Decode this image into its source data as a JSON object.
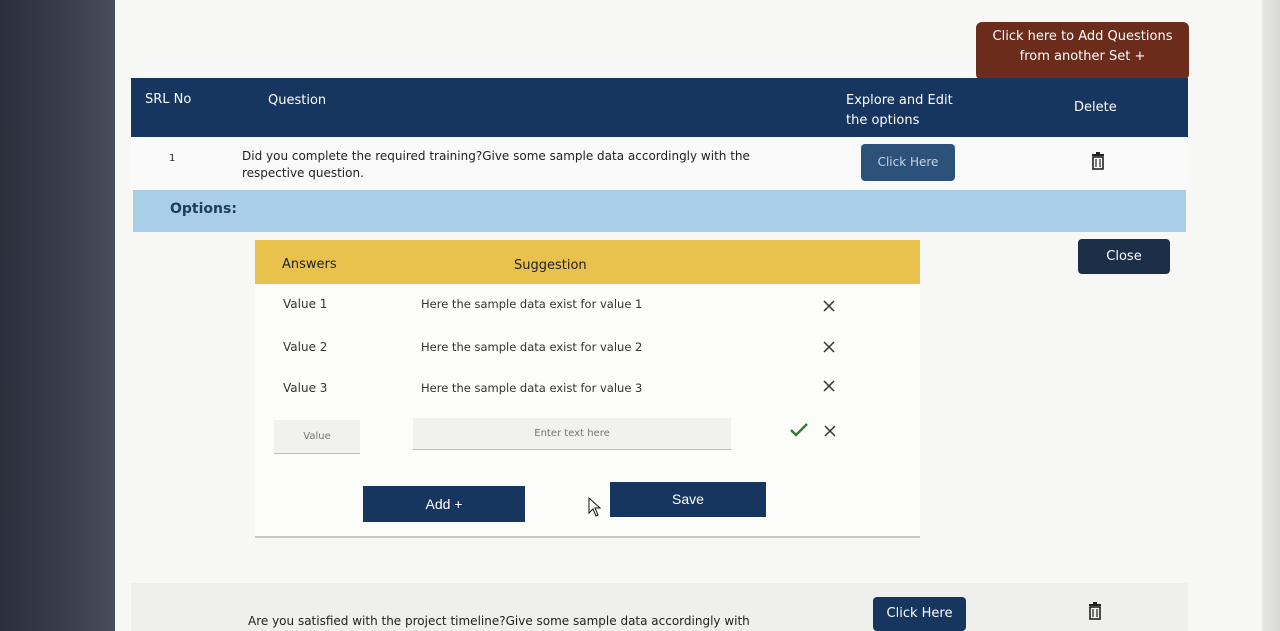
{
  "add_questions_button": {
    "line1": "Click here to Add Questions",
    "line2": "from another Set +"
  },
  "table": {
    "headers": {
      "srl": "SRL No",
      "question": "Question",
      "explore_line1": "Explore and Edit",
      "explore_line2": "the options",
      "delete": "Delete"
    },
    "rows": [
      {
        "num": "1",
        "question": "Did you complete the required training?Give some sample data accordingly with the respective question.",
        "button": "Click Here"
      },
      {
        "question": "Are you satisfied with the project timeline?Give some sample data accordingly with",
        "button": "Click Here"
      }
    ]
  },
  "options": {
    "label": "Options:",
    "headers": {
      "answers": "Answers",
      "suggestion": "Suggestion"
    },
    "items": [
      {
        "value": "Value 1",
        "suggestion": "Here the sample data exist for value 1"
      },
      {
        "value": "Value 2",
        "suggestion": "Here the sample data exist for value 2"
      },
      {
        "value": "Value 3",
        "suggestion": "Here the sample data exist for value 3"
      }
    ],
    "new_value_placeholder": "Value",
    "new_suggestion_placeholder": "Enter text here",
    "add_label": "Add +",
    "save_label": "Save",
    "close_label": "Close"
  },
  "colors": {
    "header_navy": "#17365f",
    "brown_button": "#6b2c1c",
    "options_bar": "#a8cfe7",
    "options_header": "#e8c24d",
    "check_green": "#2e7d32"
  }
}
